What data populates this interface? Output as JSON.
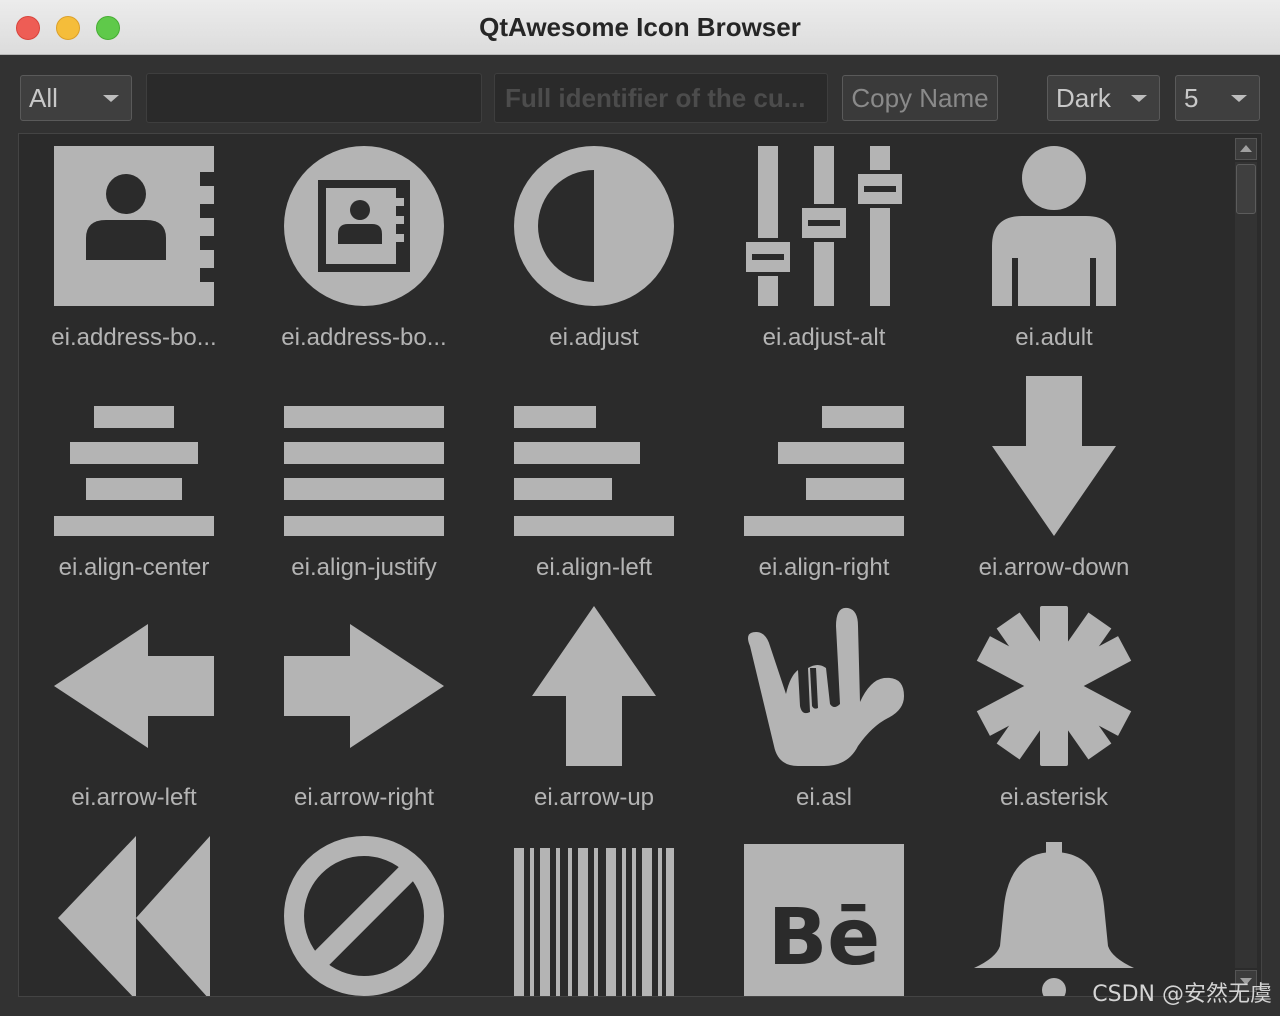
{
  "window": {
    "title": "QtAwesome Icon Browser"
  },
  "toolbar": {
    "font_filter": "All",
    "search_value": "",
    "identifier_placeholder": "Full identifier of the cu...",
    "copy_button": "Copy Name",
    "theme": "Dark",
    "columns": "5"
  },
  "colors": {
    "icon": "#b4b4b4",
    "grid_bg": "#2b2b2b",
    "window_bg": "#323232"
  },
  "icons": [
    {
      "name": "ei.address-bo...",
      "icon": "address-book-icon"
    },
    {
      "name": "ei.address-bo...",
      "icon": "address-book-alt-icon"
    },
    {
      "name": "ei.adjust",
      "icon": "adjust-icon"
    },
    {
      "name": "ei.adjust-alt",
      "icon": "adjust-alt-icon"
    },
    {
      "name": "ei.adult",
      "icon": "adult-icon"
    },
    {
      "name": "ei.align-center",
      "icon": "align-center-icon"
    },
    {
      "name": "ei.align-justify",
      "icon": "align-justify-icon"
    },
    {
      "name": "ei.align-left",
      "icon": "align-left-icon"
    },
    {
      "name": "ei.align-right",
      "icon": "align-right-icon"
    },
    {
      "name": "ei.arrow-down",
      "icon": "arrow-down-icon"
    },
    {
      "name": "ei.arrow-left",
      "icon": "arrow-left-icon"
    },
    {
      "name": "ei.arrow-right",
      "icon": "arrow-right-icon"
    },
    {
      "name": "ei.arrow-up",
      "icon": "arrow-up-icon"
    },
    {
      "name": "ei.asl",
      "icon": "asl-icon"
    },
    {
      "name": "ei.asterisk",
      "icon": "asterisk-icon"
    },
    {
      "name": "",
      "icon": "backward-icon"
    },
    {
      "name": "",
      "icon": "ban-circle-icon"
    },
    {
      "name": "",
      "icon": "barcode-icon"
    },
    {
      "name": "",
      "icon": "behance-icon"
    },
    {
      "name": "",
      "icon": "bell-icon"
    }
  ],
  "watermark": "CSDN @安然无虞"
}
